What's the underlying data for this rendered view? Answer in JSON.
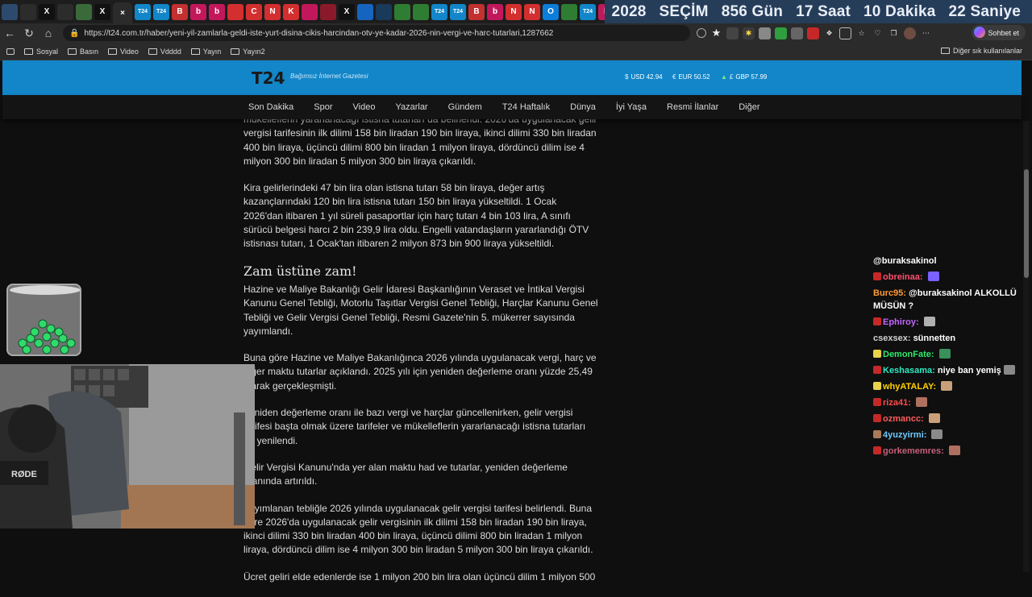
{
  "tabs": {
    "items": [
      {
        "label": "",
        "icon": "chevron-down-icon",
        "color": "#2c4a6e"
      },
      {
        "label": "",
        "icon": "copy-icon",
        "color": "#2c2c2c"
      },
      {
        "label": "X",
        "icon": "x-icon",
        "color": "#111111"
      },
      {
        "label": "",
        "icon": "discord-icon",
        "color": "#2c2c2c"
      },
      {
        "label": "",
        "icon": "tab-icon",
        "color": "#3a6a3a"
      },
      {
        "label": "X",
        "icon": "x-icon",
        "color": "#111111"
      },
      {
        "label": "×",
        "icon": "close-icon",
        "color": "#2b2b2b"
      },
      {
        "label": "T24",
        "icon": "t24-icon",
        "color": "#1286c9"
      },
      {
        "label": "T24",
        "icon": "t24-icon",
        "color": "#1286c9"
      },
      {
        "label": "B",
        "icon": "b-icon",
        "color": "#c23030"
      },
      {
        "label": "b",
        "icon": "b-icon",
        "color": "#c2185b"
      },
      {
        "label": "b",
        "icon": "b-icon",
        "color": "#c2185b"
      },
      {
        "label": "",
        "icon": "tab-icon",
        "color": "#d32f2f"
      },
      {
        "label": "C",
        "icon": "c-icon",
        "color": "#d32f2f"
      },
      {
        "label": "N",
        "icon": "n-icon",
        "color": "#d32f2f"
      },
      {
        "label": "K",
        "icon": "k-icon",
        "color": "#d32f2f"
      },
      {
        "label": "",
        "icon": "instagram-icon",
        "color": "#c2185b"
      },
      {
        "label": "",
        "icon": "tab-icon",
        "color": "#8a1a2a"
      },
      {
        "label": "X",
        "icon": "x-icon",
        "color": "#111111"
      },
      {
        "label": "",
        "icon": "tab-icon",
        "color": "#1565c0"
      },
      {
        "label": "",
        "icon": "tab-icon",
        "color": "#1a3a5a"
      },
      {
        "label": "",
        "icon": "tab-icon",
        "color": "#2e7d32"
      },
      {
        "label": "",
        "icon": "tab-icon",
        "color": "#2e7d32"
      },
      {
        "label": "T24",
        "icon": "t24-icon",
        "color": "#1286c9"
      },
      {
        "label": "T24",
        "icon": "t24-icon",
        "color": "#1286c9"
      },
      {
        "label": "B",
        "icon": "b-icon",
        "color": "#c23030"
      },
      {
        "label": "b",
        "icon": "b-icon",
        "color": "#c2185b"
      },
      {
        "label": "N",
        "icon": "n-icon",
        "color": "#d32f2f"
      },
      {
        "label": "N",
        "icon": "n-icon",
        "color": "#d32f2f"
      },
      {
        "label": "O",
        "icon": "o-icon",
        "color": "#0b7dda"
      },
      {
        "label": "",
        "icon": "tab-icon",
        "color": "#2e7d32"
      },
      {
        "label": "T24",
        "icon": "t24-icon",
        "color": "#1286c9"
      },
      {
        "label": "b",
        "icon": "b-icon",
        "color": "#c2185b"
      },
      {
        "label": "b",
        "icon": "b-icon",
        "color": "#c2185b"
      },
      {
        "label": "",
        "icon": "tab-icon",
        "color": "#d32f2f"
      },
      {
        "label": "",
        "icon": "tab-icon",
        "color": "#d32f2f"
      },
      {
        "label": "",
        "icon": "tab-icon",
        "color": "#d32f2f"
      }
    ]
  },
  "countdown": {
    "year": "2028",
    "title": "SEÇİM",
    "days": "856 Gün",
    "hours": "17 Saat",
    "minutes": "10 Dakika",
    "seconds": "22 Saniye"
  },
  "address": {
    "url": "https://t24.com.tr/haber/yeni-yil-zamlarla-geldi-iste-yurt-disina-cikis-harcindan-otv-ye-kadar-2026-nin-vergi-ve-harc-tutarlari,1287662"
  },
  "toolbar": {
    "chat_label": "Sohbet et"
  },
  "bookmarks": {
    "items": [
      "Sosyal",
      "Basın",
      "Video",
      "Vdddd",
      "Yayın",
      "Yayın2"
    ],
    "other": "Diğer sık kullanılanlar"
  },
  "site": {
    "logo": "T24",
    "tagline": "Bağımsız İnternet Gazetesi",
    "usd": "USD 42.94",
    "eur": "EUR 50.52",
    "gbp": "GBP 57.99",
    "nav": [
      "Son Dakika",
      "Spor",
      "Video",
      "Yazarlar",
      "Gündem",
      "T24 Haftalık",
      "Dünya",
      "İyi Yaşa",
      "Resmi İlanlar",
      "Diğer"
    ]
  },
  "article": {
    "p0": "mükelleflerin yararlanacağı istisna tutarları da belirlendi. 2026'da uygulanacak gelir vergisi tarifesinin ilk dilimi 158 bin liradan 190 bin liraya, ikinci dilimi 330 bin liradan 400 bin liraya, üçüncü dilimi 800 bin liradan 1 milyon liraya, dördüncü dilim ise 4 milyon 300 bin liradan 5 milyon 300 bin liraya çıkarıldı.",
    "p1": "Kira gelirlerindeki 47 bin lira olan istisna tutarı 58 bin liraya, değer artış kazançlarındaki 120 bin lira istisna tutarı 150 bin liraya yükseltildi. 1 Ocak 2026'dan itibaren 1 yıl süreli pasaportlar için harç tutarı 4 bin 103 lira, A sınıfı sürücü belgesi harcı 2 bin 239,9 lira oldu. Engelli vatandaşların yararlandığı ÖTV istisnası tutarı, 1 Ocak'tan itibaren 2 milyon 873 bin 900 liraya yükseltildi.",
    "heading": "Zam üstüne zam!",
    "p2": "Hazine ve Maliye Bakanlığı Gelir İdaresi Başkanlığının Veraset ve İntikal Vergisi Kanunu Genel Tebliği, Motorlu Taşıtlar Vergisi Genel Tebliği, Harçlar Kanunu Genel Tebliği ve Gelir Vergisi Genel Tebliği, Resmi Gazete'nin 5. mükerrer sayısında yayımlandı.",
    "p3": "Buna göre Hazine ve Maliye Bakanlığınca 2026 yılında uygulanacak vergi, harç ve diğer maktu tutarlar açıklandı. 2025 yılı için yeniden değerleme oranı yüzde 25,49 olarak gerçekleşmişti.",
    "p4": "Yeniden değerleme oranı ile bazı vergi ve harçlar güncellenirken, gelir vergisi tarifesi başta olmak üzere tarifeler ve mükelleflerin yararlanacağı istisna tutarları da yenilendi.",
    "p5": "Gelir Vergisi Kanunu'nda yer alan maktu had ve tutarlar, yeniden değerleme oranında artırıldı.",
    "p6": "Yayımlanan tebliğle 2026 yılında uygulanacak gelir vergisi tarifesi belirlendi. Buna göre 2026'da uygulanacak gelir vergisinin ilk dilimi 158 bin liradan 190 bin liraya, ikinci dilimi 330 bin liradan 400 bin liraya, üçüncü dilimi 800 bin liradan 1 milyon liraya, dördüncü dilim ise 4 milyon 300 bin liradan 5 milyon 300 bin liraya çıkarıldı.",
    "p7": "Ücret geliri elde edenlerde ise 1 milyon 200 bin lira olan üçüncü dilim 1 milyon 500"
  },
  "chat": {
    "messages": [
      {
        "user": "",
        "user_color": "#ffffff",
        "text": "@buraksakinol",
        "badge": "",
        "emote": ""
      },
      {
        "user": "obreinaa:",
        "user_color": "#ff4f6d",
        "text": "",
        "badge": "#c62828",
        "emote": "#7b61ff"
      },
      {
        "user": "Burc95:",
        "user_color": "#ff9b38",
        "text": "@buraksakinol ALKOLLÜ MÜSÜN ?",
        "badge": "",
        "emote": ""
      },
      {
        "user": "Ephiroy:",
        "user_color": "#c266ff",
        "text": "",
        "badge": "#c62828",
        "emote": "#b0b0b0"
      },
      {
        "user": "csexsex:",
        "user_color": "#d0d0d0",
        "text": "sünnetten",
        "badge": "",
        "emote": ""
      },
      {
        "user": "DemonFate:",
        "user_color": "#2ee86b",
        "text": "",
        "badge": "#e8d34a",
        "emote": "#3a8f5a"
      },
      {
        "user": "Keshasama:",
        "user_color": "#2ee8c0",
        "text": "niye ban yemiş",
        "badge": "#c62828",
        "emote": "#888888"
      },
      {
        "user": "whyATALAY:",
        "user_color": "#ffd000",
        "text": "",
        "badge": "#e8d34a",
        "emote": "#c9a07a"
      },
      {
        "user": "riza41:",
        "user_color": "#ff4a4a",
        "text": "",
        "badge": "#c62828",
        "emote": "#b07060"
      },
      {
        "user": "ozmancc:",
        "user_color": "#ff5a5a",
        "text": "",
        "badge": "#c62828",
        "emote": "#c9a07a"
      },
      {
        "user": "4yuzyirmi:",
        "user_color": "#6ec8ff",
        "text": "",
        "badge": "#a87a5a",
        "emote": "#8a8a8a"
      },
      {
        "user": "gorkememres:",
        "user_color": "#c4607a",
        "text": "",
        "badge": "#c62828",
        "emote": "#b07060"
      }
    ]
  }
}
